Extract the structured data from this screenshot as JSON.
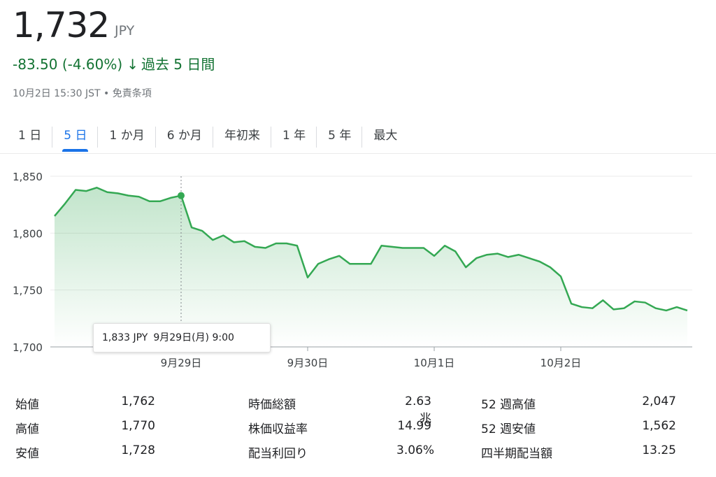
{
  "header": {
    "price": "1,732",
    "currency": "JPY",
    "change": "-83.50 (-4.60%)",
    "change_arrow": "↓",
    "period": "過去 5 日間",
    "timestamp": "10月2日 15:30 JST",
    "disclaimer": "免責条項",
    "change_color": "#137333"
  },
  "tabs": [
    "1 日",
    "5 日",
    "1 か月",
    "6 か月",
    "年初来",
    "1 年",
    "5 年",
    "最大"
  ],
  "active_tab": 1,
  "tooltip": {
    "value": "1,833 JPY",
    "datetime": "9月29日(月) 9:00"
  },
  "chart_data": {
    "type": "area",
    "ylim": [
      1700,
      1850
    ],
    "yticks": [
      1700,
      1750,
      1800,
      1850
    ],
    "ytick_labels": [
      "1,700",
      "1,750",
      "1,800",
      "1,850"
    ],
    "x_labels": [
      {
        "label": "9月29日",
        "index": 12
      },
      {
        "label": "9月30日",
        "index": 24
      },
      {
        "label": "10月1日",
        "index": 36
      },
      {
        "label": "10月2日",
        "index": 48
      }
    ],
    "values": [
      1815,
      1826,
      1838,
      1837,
      1840,
      1836,
      1835,
      1833,
      1832,
      1828,
      1828,
      1831,
      1833,
      1805,
      1802,
      1794,
      1798,
      1792,
      1793,
      1788,
      1787,
      1791,
      1791,
      1789,
      1761,
      1773,
      1777,
      1780,
      1773,
      1773,
      1773,
      1789,
      1788,
      1787,
      1787,
      1787,
      1780,
      1789,
      1784,
      1770,
      1778,
      1781,
      1782,
      1779,
      1781,
      1778,
      1775,
      1770,
      1762,
      1738,
      1735,
      1734,
      1741,
      1733,
      1734,
      1740,
      1739,
      1734,
      1732,
      1735,
      1732
    ],
    "highlight_index": 12,
    "line_color": "#34a853",
    "grid": true
  },
  "stats": [
    [
      {
        "label": "始値",
        "value": "1,762"
      },
      {
        "label": "時価総額",
        "value": "2.63兆"
      },
      {
        "label": "52 週高値",
        "value": "2,047"
      }
    ],
    [
      {
        "label": "高値",
        "value": "1,770"
      },
      {
        "label": "株価収益率",
        "value": "14.99"
      },
      {
        "label": "52 週安値",
        "value": "1,562"
      }
    ],
    [
      {
        "label": "安値",
        "value": "1,728"
      },
      {
        "label": "配当利回り",
        "value": "3.06%"
      },
      {
        "label": "四半期配当額",
        "value": "13.25"
      }
    ]
  ]
}
